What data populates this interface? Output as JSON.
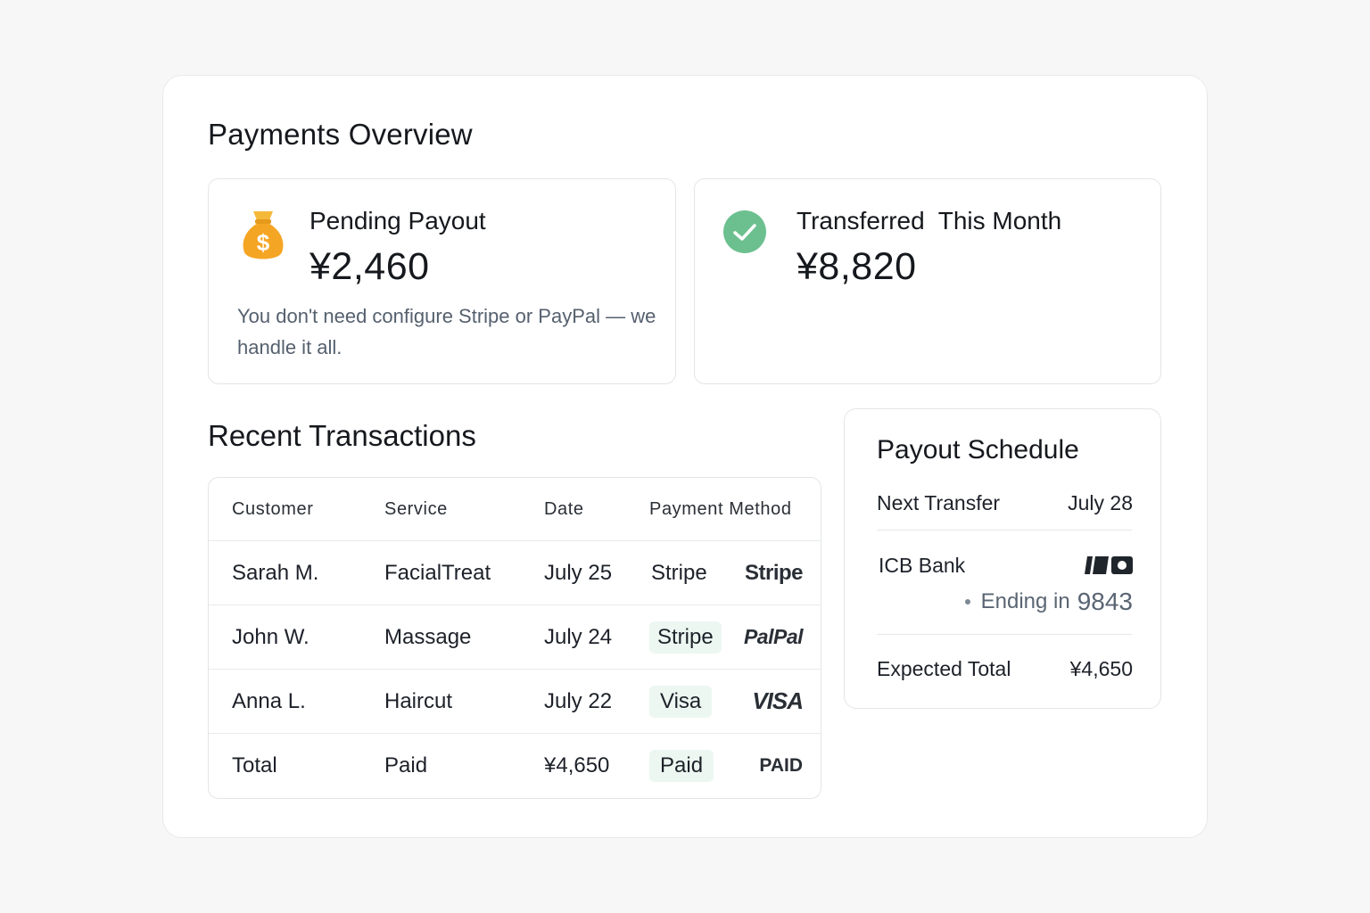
{
  "page": {
    "title": "Payments Overview"
  },
  "pending": {
    "icon": "money-bag-icon",
    "title": "Pending Payout",
    "amount": "¥2,460",
    "note": "You don't need configure Stripe or PayPal — we handle it all."
  },
  "transferred": {
    "icon": "check-circle-icon",
    "title": "Transferred  This Month",
    "amount": "¥8,820"
  },
  "transactions": {
    "title": "Recent Transactions",
    "columns": [
      "Customer",
      "Service",
      "Date",
      "Payment Method"
    ],
    "rows": [
      {
        "customer": "Sarah M.",
        "service": "FacialTreat",
        "date": "July 25",
        "method": "Stripe",
        "logo": "Stripe"
      },
      {
        "customer": "John W.",
        "service": "Massage",
        "date": "July 24",
        "method": "Stripe",
        "logo": "PalPal"
      },
      {
        "customer": "Anna L.",
        "service": "Haircut",
        "date": "July 22",
        "method": "Visa",
        "logo": "VISA"
      },
      {
        "customer": "Total",
        "service": "Paid",
        "date": "¥4,650",
        "method": "Paid",
        "logo": "PAID"
      }
    ]
  },
  "schedule": {
    "title": "Payout Schedule",
    "next_label": "Next Transfer",
    "next_value": "July 28",
    "bank_name": "ICB Bank",
    "bank_icon": "bank-card-icon",
    "ending_label": "Ending in",
    "ending_number": "9843",
    "expected_label": "Expected Total",
    "expected_value": "¥4,650"
  },
  "colors": {
    "accent_green": "#6cc08f",
    "bag_orange": "#f5a524",
    "pill_bg": "#ecf7f1"
  }
}
